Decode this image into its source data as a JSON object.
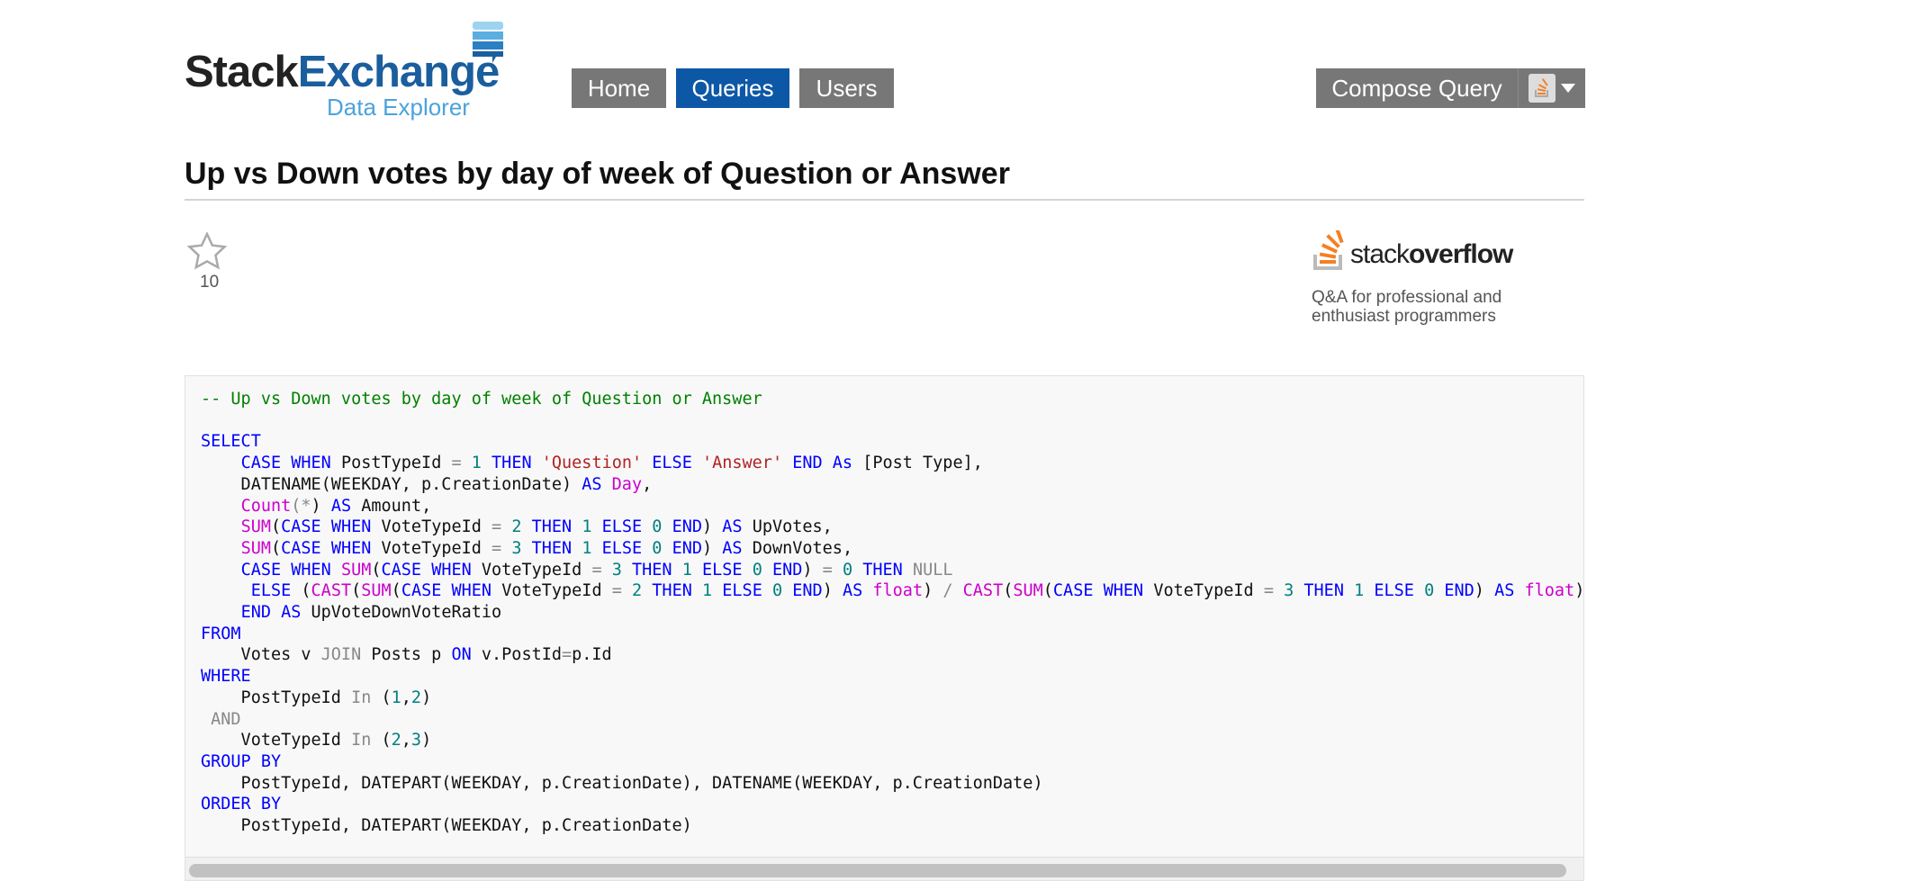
{
  "logo": {
    "brand_a": "Stack",
    "brand_b": "Exchange",
    "sub": "Data Explorer"
  },
  "nav": {
    "home": "Home",
    "queries": "Queries",
    "users": "Users",
    "active": "Queries",
    "active_color": "#0d58a6"
  },
  "compose": {
    "label": "Compose Query",
    "site_icon": "stackoverflow-icon"
  },
  "query": {
    "title": "Up vs Down votes by day of week of Question or Answer",
    "favorites": "10"
  },
  "site": {
    "name_a": "stack",
    "name_b": "overflow",
    "tagline": "Q&A for professional and enthusiast programmers"
  },
  "code": [
    [
      [
        "c",
        "-- Up vs Down votes by day of week of Question or Answer"
      ]
    ],
    [],
    [
      [
        "k",
        "SELECT"
      ]
    ],
    [
      [
        "p",
        "    "
      ],
      [
        "k",
        "CASE WHEN "
      ],
      [
        "p",
        "PostTypeId "
      ],
      [
        "g",
        "= "
      ],
      [
        "n",
        "1 "
      ],
      [
        "k",
        "THEN "
      ],
      [
        "s",
        "'Question' "
      ],
      [
        "k",
        "ELSE "
      ],
      [
        "s",
        "'Answer' "
      ],
      [
        "k",
        "END As "
      ],
      [
        "p",
        "[Post Type],"
      ]
    ],
    [
      [
        "p",
        "    DATENAME(WEEKDAY, p.CreationDate) "
      ],
      [
        "k",
        "AS "
      ],
      [
        "f",
        "Day"
      ],
      [
        "p",
        ","
      ]
    ],
    [
      [
        "p",
        "    "
      ],
      [
        "f",
        "Count"
      ],
      [
        "g",
        "(*"
      ],
      [
        "p",
        ") "
      ],
      [
        "k",
        "AS "
      ],
      [
        "p",
        "Amount,"
      ]
    ],
    [
      [
        "p",
        "    "
      ],
      [
        "f",
        "SUM"
      ],
      [
        "p",
        "("
      ],
      [
        "k",
        "CASE WHEN "
      ],
      [
        "p",
        "VoteTypeId "
      ],
      [
        "g",
        "= "
      ],
      [
        "n",
        "2 "
      ],
      [
        "k",
        "THEN "
      ],
      [
        "n",
        "1 "
      ],
      [
        "k",
        "ELSE "
      ],
      [
        "n",
        "0 "
      ],
      [
        "k",
        "END"
      ],
      [
        "p",
        ") "
      ],
      [
        "k",
        "AS "
      ],
      [
        "p",
        "UpVotes,"
      ]
    ],
    [
      [
        "p",
        "    "
      ],
      [
        "f",
        "SUM"
      ],
      [
        "p",
        "("
      ],
      [
        "k",
        "CASE WHEN "
      ],
      [
        "p",
        "VoteTypeId "
      ],
      [
        "g",
        "= "
      ],
      [
        "n",
        "3 "
      ],
      [
        "k",
        "THEN "
      ],
      [
        "n",
        "1 "
      ],
      [
        "k",
        "ELSE "
      ],
      [
        "n",
        "0 "
      ],
      [
        "k",
        "END"
      ],
      [
        "p",
        ") "
      ],
      [
        "k",
        "AS "
      ],
      [
        "p",
        "DownVotes,"
      ]
    ],
    [
      [
        "p",
        "    "
      ],
      [
        "k",
        "CASE WHEN "
      ],
      [
        "f",
        "SUM"
      ],
      [
        "p",
        "("
      ],
      [
        "k",
        "CASE WHEN "
      ],
      [
        "p",
        "VoteTypeId "
      ],
      [
        "g",
        "= "
      ],
      [
        "n",
        "3 "
      ],
      [
        "k",
        "THEN "
      ],
      [
        "n",
        "1 "
      ],
      [
        "k",
        "ELSE "
      ],
      [
        "n",
        "0 "
      ],
      [
        "k",
        "END"
      ],
      [
        "p",
        ") "
      ],
      [
        "g",
        "= "
      ],
      [
        "n",
        "0 "
      ],
      [
        "k",
        "THEN "
      ],
      [
        "g",
        "NULL"
      ]
    ],
    [
      [
        "p",
        "     "
      ],
      [
        "k",
        "ELSE "
      ],
      [
        "p",
        "("
      ],
      [
        "f",
        "CAST"
      ],
      [
        "p",
        "("
      ],
      [
        "f",
        "SUM"
      ],
      [
        "p",
        "("
      ],
      [
        "k",
        "CASE WHEN "
      ],
      [
        "p",
        "VoteTypeId "
      ],
      [
        "g",
        "= "
      ],
      [
        "n",
        "2 "
      ],
      [
        "k",
        "THEN "
      ],
      [
        "n",
        "1 "
      ],
      [
        "k",
        "ELSE "
      ],
      [
        "n",
        "0 "
      ],
      [
        "k",
        "END"
      ],
      [
        "p",
        ") "
      ],
      [
        "k",
        "AS "
      ],
      [
        "f",
        "float"
      ],
      [
        "p",
        ") "
      ],
      [
        "g",
        "/ "
      ],
      [
        "f",
        "CAST"
      ],
      [
        "p",
        "("
      ],
      [
        "f",
        "SUM"
      ],
      [
        "p",
        "("
      ],
      [
        "k",
        "CASE WHEN "
      ],
      [
        "p",
        "VoteTypeId "
      ],
      [
        "g",
        "= "
      ],
      [
        "n",
        "3 "
      ],
      [
        "k",
        "THEN "
      ],
      [
        "n",
        "1 "
      ],
      [
        "k",
        "ELSE "
      ],
      [
        "n",
        "0 "
      ],
      [
        "k",
        "END"
      ],
      [
        "p",
        ") "
      ],
      [
        "k",
        "AS "
      ],
      [
        "f",
        "float"
      ],
      [
        "p",
        ")"
      ]
    ],
    [
      [
        "p",
        "    "
      ],
      [
        "k",
        "END AS "
      ],
      [
        "p",
        "UpVoteDownVoteRatio"
      ]
    ],
    [
      [
        "k",
        "FROM"
      ]
    ],
    [
      [
        "p",
        "    Votes v "
      ],
      [
        "g",
        "JOIN "
      ],
      [
        "p",
        "Posts p "
      ],
      [
        "k",
        "ON "
      ],
      [
        "p",
        "v.PostId"
      ],
      [
        "g",
        "="
      ],
      [
        "p",
        "p.Id"
      ]
    ],
    [
      [
        "k",
        "WHERE"
      ]
    ],
    [
      [
        "p",
        "    PostTypeId "
      ],
      [
        "g",
        "In "
      ],
      [
        "p",
        "("
      ],
      [
        "n",
        "1"
      ],
      [
        "p",
        ","
      ],
      [
        "n",
        "2"
      ],
      [
        "p",
        ")"
      ]
    ],
    [
      [
        "p",
        " "
      ],
      [
        "g",
        "AND"
      ]
    ],
    [
      [
        "p",
        "    VoteTypeId "
      ],
      [
        "g",
        "In "
      ],
      [
        "p",
        "("
      ],
      [
        "n",
        "2"
      ],
      [
        "p",
        ","
      ],
      [
        "n",
        "3"
      ],
      [
        "p",
        ")"
      ]
    ],
    [
      [
        "k",
        "GROUP BY"
      ]
    ],
    [
      [
        "p",
        "    PostTypeId, DATEPART(WEEKDAY, p.CreationDate), DATENAME(WEEKDAY, p.CreationDate)"
      ]
    ],
    [
      [
        "k",
        "ORDER BY"
      ]
    ],
    [
      [
        "p",
        "    PostTypeId, DATEPART(WEEKDAY, p.CreationDate)"
      ]
    ]
  ]
}
